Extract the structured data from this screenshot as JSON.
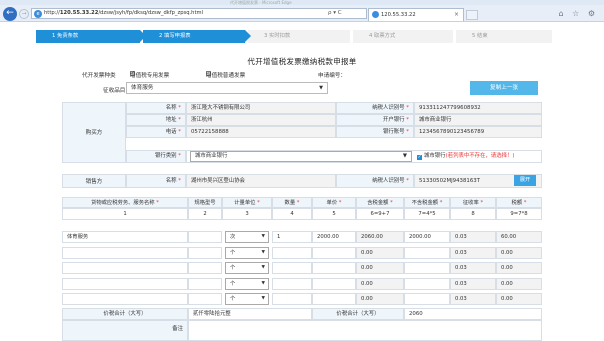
{
  "browser": {
    "title_blur": "代开增值税发票 - Microsoft Edge",
    "url_prefix": "http://",
    "url_host": "120.55.33.22",
    "url_path": "/dzsw/jsyh/fp/dksq/dzsw_dkfp_zpsq.html",
    "url_tools": "ρ ▾ C",
    "tab_title": "120.55.33.22",
    "tab_close": "×",
    "right_icons": "⌂ ☆ ⚙"
  },
  "steps": [
    {
      "label": "1  免责条款"
    },
    {
      "label": "2  填写申报表"
    },
    {
      "label": "3  实时扣款"
    },
    {
      "label": "4  取票方式"
    },
    {
      "label": "5  结束"
    }
  ],
  "form": {
    "title": "代开增值税发票缴纳税款申报单",
    "invoice_type_label": "代开发票种类",
    "special_invoice": "增值税专用发票",
    "normal_invoice": "增值税普通发票",
    "apply_no_label": "申请编号：",
    "category_label": "征收品目：",
    "category_value": "体育服务",
    "copy_button": "复制上一张"
  },
  "buyer": {
    "side_label": "购买方",
    "name_label": "名称",
    "name_value": "浙江隆大不锈钢有限公司",
    "addr_label": "地址",
    "addr_value": "浙江杭州",
    "phone_label": "电话",
    "phone_value": "05722158888",
    "bank_type_label": "银行类别",
    "bank_type_value": "城市商业银行",
    "taxid_label": "纳税人识别号",
    "taxid_value": "913311247799608932",
    "bank_label": "开户银行",
    "bank_value": "城市商业银行",
    "account_label": "银行账号",
    "account_value": "1234567890123456789",
    "bank_check_text": "城市银行",
    "bank_warning": "(若列表中不存在，请选择！)"
  },
  "seller": {
    "side_label": "销售方",
    "name_label": "名称",
    "name_value": "湖州市吴兴区登山协会",
    "taxid_label": "纳税人识别号",
    "taxid_value": "51330502MJ9438163T",
    "open_button": "展开"
  },
  "goods_table": {
    "headers": [
      "货物或应税劳务、服务名称",
      "规格型号",
      "计量单位",
      "数量",
      "单价",
      "含税金额",
      "不含税金额",
      "征收率",
      "税额"
    ],
    "index_row": [
      "1",
      "2",
      "3",
      "4",
      "5",
      "6=9+7",
      "7=4*5",
      "8",
      "9=7*8"
    ],
    "rows": [
      {
        "name": "体育服务",
        "spec": "",
        "unit": "次",
        "qty": "1",
        "price": "2000.00",
        "gross": "2060.00",
        "net": "2000.00",
        "rate": "0.03",
        "tax": "60.00"
      },
      {
        "name": "",
        "spec": "",
        "unit": "个",
        "qty": "",
        "price": "",
        "gross": "0.00",
        "net": "",
        "rate": "0.03",
        "tax": "0.00"
      },
      {
        "name": "",
        "spec": "",
        "unit": "个",
        "qty": "",
        "price": "",
        "gross": "0.00",
        "net": "",
        "rate": "0.03",
        "tax": "0.00"
      },
      {
        "name": "",
        "spec": "",
        "unit": "个",
        "qty": "",
        "price": "",
        "gross": "0.00",
        "net": "",
        "rate": "0.03",
        "tax": "0.00"
      },
      {
        "name": "",
        "spec": "",
        "unit": "个",
        "qty": "",
        "price": "",
        "gross": "0.00",
        "net": "",
        "rate": "0.03",
        "tax": "0.00"
      }
    ],
    "total_upper_label": "价税合计（大写）",
    "total_upper_value": "贰仟零陆拾元整",
    "total_lower_label": "价税合计（大写）",
    "total_lower_value": "2060",
    "remark_label": "备注"
  }
}
